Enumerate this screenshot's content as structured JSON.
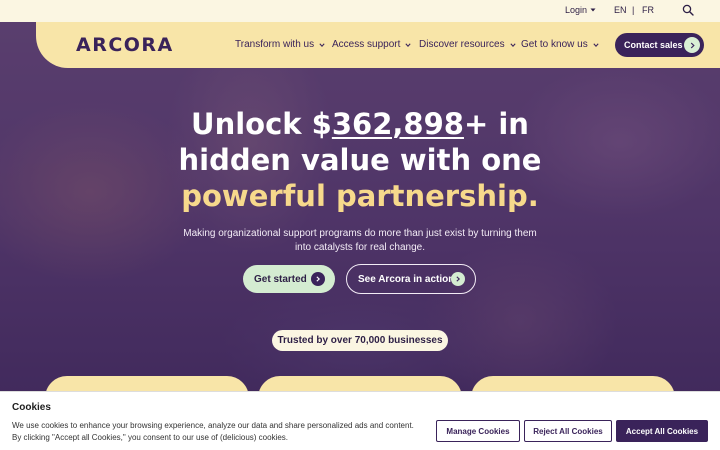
{
  "utility_bar": {
    "login_label": "Login",
    "lang_en": "EN",
    "separator": "|",
    "lang_fr": "FR",
    "search_icon": "search-icon"
  },
  "nav": {
    "logo": "ARCORA",
    "items": [
      {
        "label": "Transform with us"
      },
      {
        "label": "Access support"
      },
      {
        "label": "Discover resources"
      },
      {
        "label": "Get to know us"
      }
    ],
    "contact_label": "Contact sales"
  },
  "hero": {
    "headline_prefix": "Unlock $",
    "headline_number": "362,898",
    "headline_suffix": "+ in",
    "headline_line2": "hidden value with one",
    "headline_accent": "powerful partnership.",
    "subtext": "Making organizational support programs do more than just exist by turning them into catalysts for real change.",
    "primary_cta": "Get started",
    "secondary_cta": "See Arcora in action",
    "trusted_label": "Trusted by over 70,000 businesses"
  },
  "cookie_banner": {
    "title": "Cookies",
    "text": "We use cookies to enhance your browsing experience, analyze our data and share personalized ads and content. By clicking \"Accept all Cookies,\" you consent to our use of (delicious) cookies.",
    "manage_label": "Manage Cookies",
    "reject_label": "Reject All Cookies",
    "accept_label": "Accept All Cookies"
  },
  "colors": {
    "brand_purple": "#3a235a",
    "nav_yellow": "#f8e5a8",
    "accent_yellow": "#f7d98c",
    "mint": "#d4ecd1",
    "cream": "#fbf6e2"
  }
}
